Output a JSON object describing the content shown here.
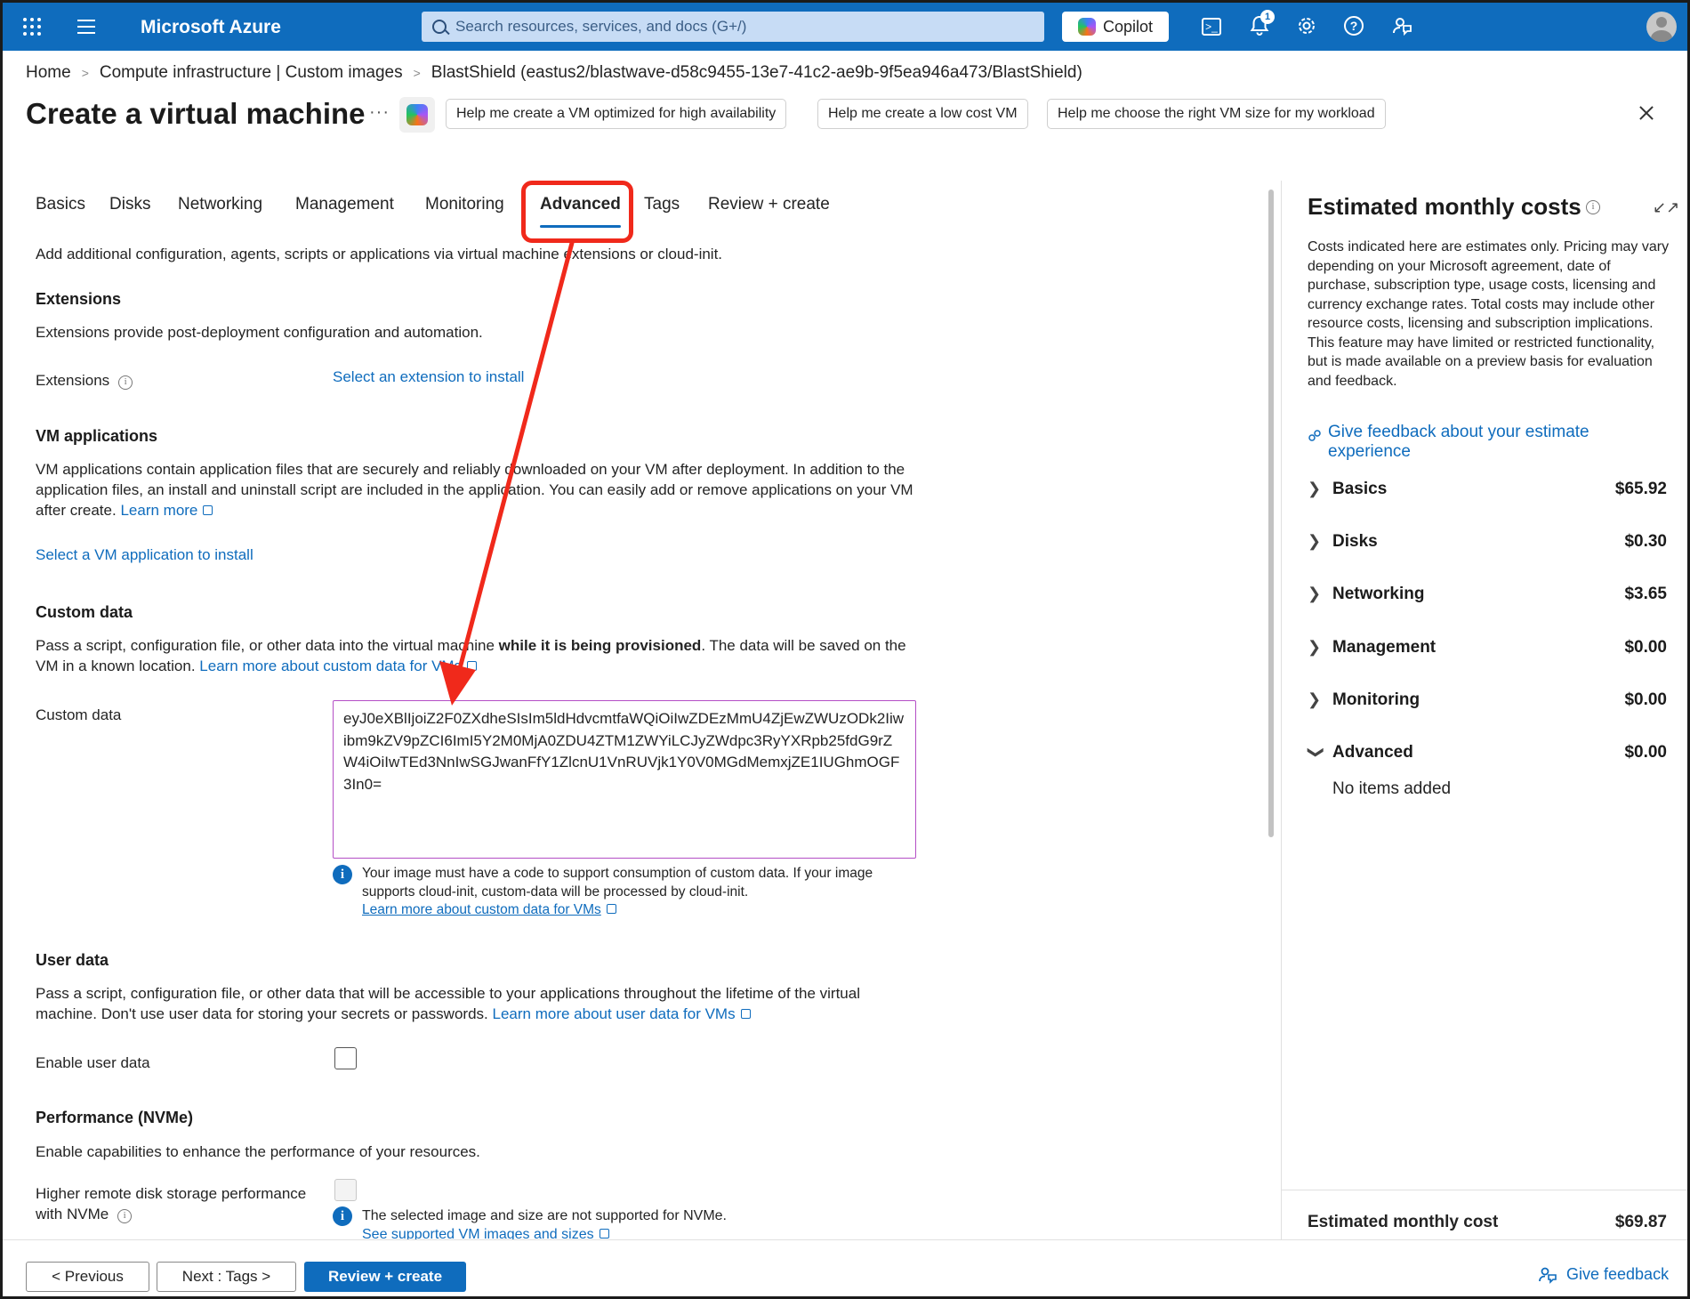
{
  "topbar": {
    "brand": "Microsoft Azure",
    "search_placeholder": "Search resources, services, and docs (G+/)",
    "copilot_label": "Copilot",
    "notification_count": "1"
  },
  "breadcrumb": {
    "items": [
      "Home",
      "Compute infrastructure | Custom images",
      "BlastShield (eastus2/blastwave-d58c9455-13e7-41c2-ae9b-9f5ea946a473/BlastShield)"
    ]
  },
  "header": {
    "title": "Create a virtual machine",
    "more": "···",
    "suggestions": [
      "Help me create a VM optimized for high availability",
      "Help me create a low cost VM",
      "Help me choose the right VM size for my workload"
    ]
  },
  "tabs": {
    "items": [
      "Basics",
      "Disks",
      "Networking",
      "Management",
      "Monitoring",
      "Advanced",
      "Tags",
      "Review + create"
    ],
    "active": "Advanced"
  },
  "advanced": {
    "intro": "Add additional configuration, agents, scripts or applications via virtual machine extensions or cloud-init.",
    "extensions": {
      "heading": "Extensions",
      "desc": "Extensions provide post-deployment configuration and automation.",
      "label": "Extensions",
      "link": "Select an extension to install"
    },
    "vm_apps": {
      "heading": "VM applications",
      "desc": "VM applications contain application files that are securely and reliably downloaded on your VM after deployment. In addition to the application files, an install and uninstall script are included in the application. You can easily add or remove applications on your VM after create.",
      "learn_more": "Learn more",
      "link": "Select a VM application to install"
    },
    "custom_data": {
      "heading": "Custom data",
      "desc_prefix": "Pass a script, configuration file, or other data into the virtual machine ",
      "desc_bold": "while it is being provisioned",
      "desc_suffix": ". The data will be saved on the VM in a known location.",
      "learn_more": "Learn more about custom data for VMs",
      "label": "Custom data",
      "value": "eyJ0eXBlIjoiZ2F0ZXdheSIsIm5ldHdvcmtfaWQiOiIwZDEzMmU4ZjEwZWUzODk2Iiwibm9kZV9pZCI6ImI5Y2M0MjA0ZDU4ZTM1ZWYiLCJyZWdpc3RyYXRpb25fdG9rZW4iOiIwTEd3NnIwSGJwanFfY1ZlcnU1VnRUVjk1Y0V0MGdMemxjZE1IUGhmOGF3In0=",
      "note": "Your image must have a code to support consumption of custom data. If your image supports cloud-init, custom-data will be processed by cloud-init.",
      "note_link": "Learn more about custom data for VMs"
    },
    "user_data": {
      "heading": "User data",
      "desc": "Pass a script, configuration file, or other data that will be accessible to your applications throughout the lifetime of the virtual machine. Don't use user data for storing your secrets or passwords.",
      "learn_more": "Learn more about user data for VMs",
      "label": "Enable user data"
    },
    "performance": {
      "heading": "Performance (NVMe)",
      "desc": "Enable capabilities to enhance the performance of your resources.",
      "label_line1": "Higher remote disk storage performance",
      "label_line2": "with NVMe",
      "note": "The selected image and size are not supported for NVMe.",
      "note_link": "See supported VM images and sizes"
    }
  },
  "costs": {
    "title": "Estimated monthly costs",
    "desc": "Costs indicated here are estimates only. Pricing may vary depending on your Microsoft agreement, date of purchase, subscription type, usage costs, licensing and currency exchange rates. Total costs may include other resource costs, licensing and subscription implications. This feature may have limited or restricted functionality, but is made available on a preview basis for evaluation and feedback.",
    "feedback_link": "Give feedback about your estimate experience",
    "rows": [
      {
        "label": "Basics",
        "amount": "$65.92",
        "expanded": false
      },
      {
        "label": "Disks",
        "amount": "$0.30",
        "expanded": false
      },
      {
        "label": "Networking",
        "amount": "$3.65",
        "expanded": false
      },
      {
        "label": "Management",
        "amount": "$0.00",
        "expanded": false
      },
      {
        "label": "Monitoring",
        "amount": "$0.00",
        "expanded": false
      },
      {
        "label": "Advanced",
        "amount": "$0.00",
        "expanded": true
      }
    ],
    "advanced_empty": "No items added",
    "total_label": "Estimated monthly cost",
    "total_amount": "$69.87"
  },
  "footer": {
    "previous": "< Previous",
    "next": "Next : Tags >",
    "review": "Review + create",
    "give_feedback": "Give feedback"
  },
  "colors": {
    "accent": "#0f6cbd",
    "annotation": "#f0291b",
    "textarea_border": "#b44fc6"
  }
}
